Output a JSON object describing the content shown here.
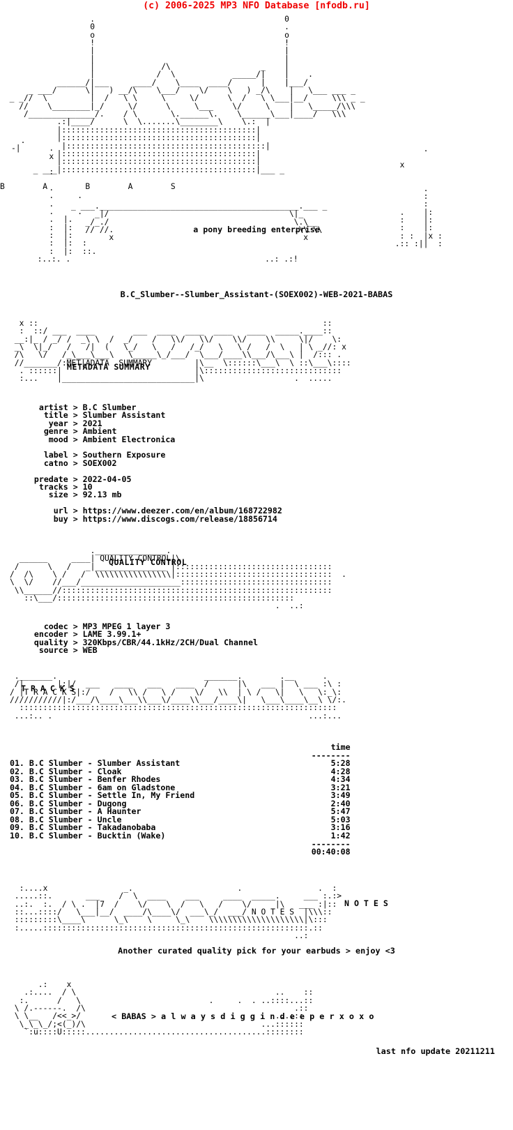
{
  "header": {
    "copyright": "(c) 2006-2025 MP3 NFO Database [nfodb.ru]",
    "color": "#ef0000"
  },
  "logo": {
    "group_letters": "B        A        B        A        S",
    "tagline": "a pony breeding enterprise",
    "ascii": [
      "                     .                                       0",
      "                     0                                       .",
      "                     o                                       o",
      "                     !                                       !",
      "                     |                                       |",
      "                     |                                       |",
      "                     |              /\\                _      |  .",
      "               _____ |   _   ___   /  \\  ___   _____ ) \\  __ |__/",
      "        ____ \\     \\_|__) __/    \\/    \\/   \\_/     \\   \\/  \\|_____",
      "  _ __ ///  \\      /  .  /  \\     /\\      \\_/   \\    \\   |  /     \\\\  ///_ _",
      "     //  \\____/|  /___/   \\___\\  /  \\__  __/\\___/ \\__ |\\_/ \\_____/  \\///",
      "      /_______/.:|______________/    \\::::::________\\::|",
      "            .:::|:::::::::::::::::::::::::::::::::::::|",
      "            |:::::::::::::::::::::::::::::::::::::::::|",
      "            |:::::::::::::::::::::::::::::::::::::::::|",
      "            |:::::::::::::::::::::::::::::::::::::::::|",
      "       _ ___|:::::::::::::::::::::::::::::::::::::::::|___ _"
    ]
  },
  "release": {
    "title_line": "B.C_Slumber--Slumber_Assistant-(SOEX002)-WEB-2021-BABAS"
  },
  "sections": {
    "metadata_label": "METADATA SUMMARY",
    "quality_label": "QUALITY CONTROL",
    "tracks_label": "T R A C K S",
    "notes_label": "N O T E S"
  },
  "metadata": {
    "groups": [
      [
        {
          "key": "artist",
          "value": "B.C Slumber"
        },
        {
          "key": "title",
          "value": "Slumber Assistant"
        },
        {
          "key": "year",
          "value": "2021"
        },
        {
          "key": "genre",
          "value": "Ambient"
        },
        {
          "key": "mood",
          "value": "Ambient Electronica"
        }
      ],
      [
        {
          "key": "label",
          "value": "Southern Exposure"
        },
        {
          "key": "catno",
          "value": "SOEX002"
        }
      ],
      [
        {
          "key": "predate",
          "value": "2022-04-05"
        },
        {
          "key": "tracks",
          "value": "10"
        },
        {
          "key": "size",
          "value": "92.13 mb"
        }
      ],
      [
        {
          "key": "url",
          "value": "https://www.deezer.com/en/album/168722982"
        },
        {
          "key": "buy",
          "value": "https://www.discogs.com/release/18856714"
        }
      ]
    ]
  },
  "quality": {
    "rows": [
      {
        "key": "codec",
        "value": "MP3 MPEG 1 layer 3"
      },
      {
        "key": "encoder",
        "value": "LAME 3.99.1+"
      },
      {
        "key": "quality",
        "value": "320Kbps/CBR/44.1kHz/2CH/Dual Channel"
      },
      {
        "key": "source",
        "value": "WEB"
      }
    ]
  },
  "tracklist": {
    "time_header": "time",
    "time_rule": "--------",
    "total_rule": "--------",
    "total": "00:40:08",
    "tracks": [
      {
        "num": "01.",
        "artist": "B.C Slumber",
        "title": "Slumber Assistant",
        "time": "5:28"
      },
      {
        "num": "02.",
        "artist": "B.C Slumber",
        "title": "Cloak",
        "time": "4:28"
      },
      {
        "num": "03.",
        "artist": "B.C Slumber",
        "title": "Benfer Rhodes",
        "time": "4:34"
      },
      {
        "num": "04.",
        "artist": "B.C Slumber",
        "title": "6am on Gladstone",
        "time": "3:21"
      },
      {
        "num": "05.",
        "artist": "B.C Slumber",
        "title": "Settle In, My Friend",
        "time": "3:49"
      },
      {
        "num": "06.",
        "artist": "B.C Slumber",
        "title": "Dugong",
        "time": "2:40"
      },
      {
        "num": "07.",
        "artist": "B.C Slumber",
        "title": "A Haunter",
        "time": "5:47"
      },
      {
        "num": "08.",
        "artist": "B.C Slumber",
        "title": "Uncle",
        "time": "5:03"
      },
      {
        "num": "09.",
        "artist": "B.C Slumber",
        "title": "Takadanobaba",
        "time": "3:16"
      },
      {
        "num": "10.",
        "artist": "B.C Slumber",
        "title": "Bucktin (Wake)",
        "time": "1:42"
      }
    ]
  },
  "notes": {
    "text": "Another curated quality pick for your earbuds > enjoy <3"
  },
  "footer": {
    "group_sig": "< BABAS >",
    "slogan": "a l w a y s  d i g g i n  d e e p e r  x o x o",
    "last_update": "last nfo update 20211211"
  }
}
